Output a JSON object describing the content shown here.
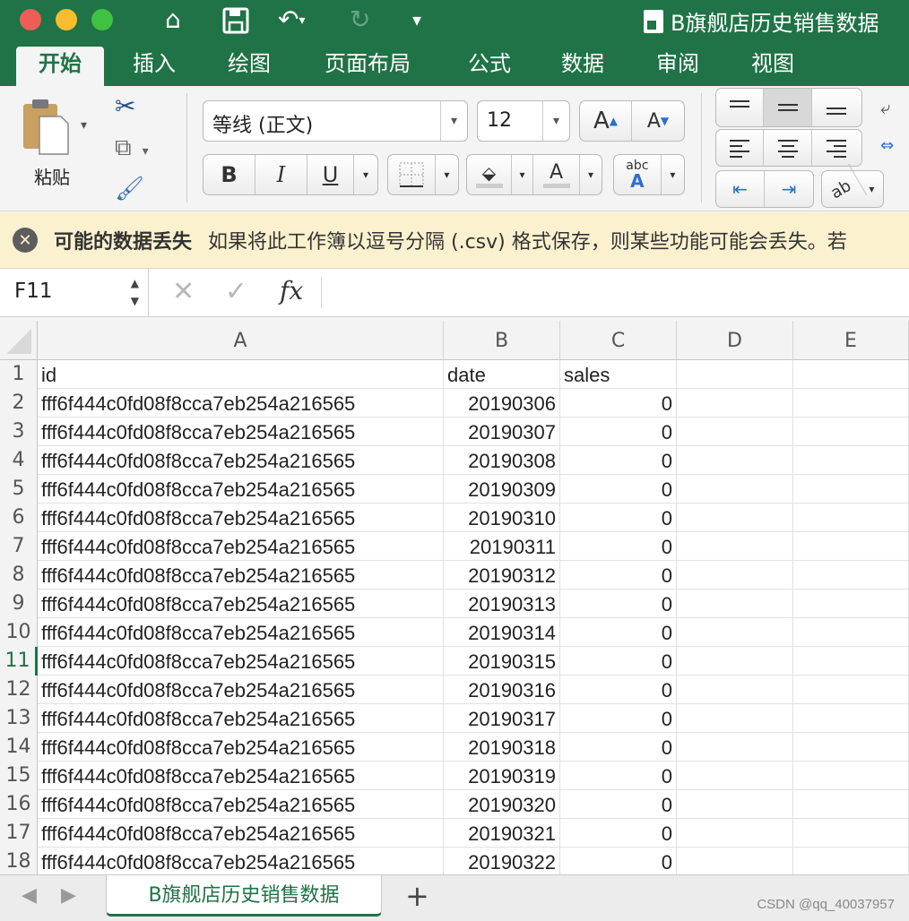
{
  "window": {
    "title": "B旗舰店历史销售数据",
    "traffic_lights": [
      {
        "color": "#ee5e56"
      },
      {
        "color": "#f8bd2f"
      },
      {
        "color": "#3fc141"
      }
    ]
  },
  "quick_access": {
    "icons": [
      "home-icon",
      "save-icon",
      "undo-icon",
      "redo-icon",
      "customize-icon"
    ]
  },
  "ribbon_tabs": [
    "开始",
    "插入",
    "绘图",
    "页面布局",
    "公式",
    "数据",
    "审阅",
    "视图"
  ],
  "ribbon": {
    "paste_label": "粘贴",
    "font_name": "等线 (正文)",
    "font_size": "12",
    "bold": "B",
    "italic": "I",
    "underline": "U",
    "font_color_letter": "A",
    "abc_label": "abc"
  },
  "warning": {
    "title": "可能的数据丢失",
    "message": "如果将此工作簿以逗号分隔 (.csv) 格式保存，则某些功能可能会丢失。若"
  },
  "formula_bar": {
    "name_box": "F11",
    "fx": "fx",
    "formula": ""
  },
  "columns": [
    "A",
    "B",
    "C",
    "D",
    "E"
  ],
  "rows": [
    {
      "num": "1",
      "a": "id",
      "b": "date",
      "c": "sales"
    },
    {
      "num": "2",
      "a": "fff6f444c0fd08f8cca7eb254a216565",
      "b": "20190306",
      "c": "0"
    },
    {
      "num": "3",
      "a": "fff6f444c0fd08f8cca7eb254a216565",
      "b": "20190307",
      "c": "0"
    },
    {
      "num": "4",
      "a": "fff6f444c0fd08f8cca7eb254a216565",
      "b": "20190308",
      "c": "0"
    },
    {
      "num": "5",
      "a": "fff6f444c0fd08f8cca7eb254a216565",
      "b": "20190309",
      "c": "0"
    },
    {
      "num": "6",
      "a": "fff6f444c0fd08f8cca7eb254a216565",
      "b": "20190310",
      "c": "0"
    },
    {
      "num": "7",
      "a": "fff6f444c0fd08f8cca7eb254a216565",
      "b": "20190311",
      "c": "0"
    },
    {
      "num": "8",
      "a": "fff6f444c0fd08f8cca7eb254a216565",
      "b": "20190312",
      "c": "0"
    },
    {
      "num": "9",
      "a": "fff6f444c0fd08f8cca7eb254a216565",
      "b": "20190313",
      "c": "0"
    },
    {
      "num": "10",
      "a": "fff6f444c0fd08f8cca7eb254a216565",
      "b": "20190314",
      "c": "0"
    },
    {
      "num": "11",
      "a": "fff6f444c0fd08f8cca7eb254a216565",
      "b": "20190315",
      "c": "0"
    },
    {
      "num": "12",
      "a": "fff6f444c0fd08f8cca7eb254a216565",
      "b": "20190316",
      "c": "0"
    },
    {
      "num": "13",
      "a": "fff6f444c0fd08f8cca7eb254a216565",
      "b": "20190317",
      "c": "0"
    },
    {
      "num": "14",
      "a": "fff6f444c0fd08f8cca7eb254a216565",
      "b": "20190318",
      "c": "0"
    },
    {
      "num": "15",
      "a": "fff6f444c0fd08f8cca7eb254a216565",
      "b": "20190319",
      "c": "0"
    },
    {
      "num": "16",
      "a": "fff6f444c0fd08f8cca7eb254a216565",
      "b": "20190320",
      "c": "0"
    },
    {
      "num": "17",
      "a": "fff6f444c0fd08f8cca7eb254a216565",
      "b": "20190321",
      "c": "0"
    },
    {
      "num": "18",
      "a": "fff6f444c0fd08f8cca7eb254a216565",
      "b": "20190322",
      "c": "0"
    }
  ],
  "selected_row": "11",
  "sheet_tab": "B旗舰店历史销售数据",
  "watermark": "CSDN @qq_40037957",
  "colors": {
    "accent": "#1f7346",
    "warning_bg": "#fcf1cf"
  }
}
